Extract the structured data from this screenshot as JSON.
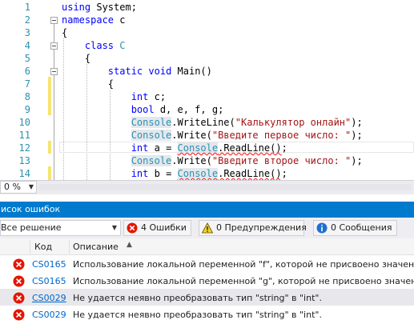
{
  "editor": {
    "lines": [
      {
        "n": "1",
        "html": "<span class=\"kw\">using</span> System;"
      },
      {
        "n": "2",
        "html": "<span class=\"kw\">namespace</span> c"
      },
      {
        "n": "3",
        "html": "{"
      },
      {
        "n": "4",
        "html": "    <span class=\"kw\">class</span> <span class=\"cls\">C</span>"
      },
      {
        "n": "5",
        "html": "    {"
      },
      {
        "n": "6",
        "html": "        <span class=\"kw\">static</span> <span class=\"kw\">void</span> Main()"
      },
      {
        "n": "7",
        "html": "        {"
      },
      {
        "n": "8",
        "html": "            <span class=\"kw\">int</span> c;"
      },
      {
        "n": "9",
        "html": "            <span class=\"kw\">bool</span> d, e, f, g;"
      },
      {
        "n": "10",
        "html": "            <span class=\"console\">Console</span>.WriteLine(<span class=\"str\">\"Калькулятор онлайн\"</span>);"
      },
      {
        "n": "11",
        "html": "            <span class=\"console\">Console</span>.Write(<span class=\"str\">\"Введите первое число: \"</span>);"
      },
      {
        "n": "12",
        "html": "            <span class=\"kw\">int</span> a = <span class=\"console squig\">Console</span><span class=\"squig\">.ReadLine()</span>;"
      },
      {
        "n": "13",
        "html": "            <span class=\"console\">Console</span>.Write(<span class=\"str\">\"Введите второе число: \"</span>);"
      },
      {
        "n": "14",
        "html": "            <span class=\"kw\">int</span> b = <span class=\"console squig\">Console</span><span class=\"squig\">.ReadLine()</span>;"
      }
    ]
  },
  "zoom": {
    "value": "0 %"
  },
  "error_list": {
    "title": "исок ошибок",
    "scope": "Все решение",
    "errors_btn": "4 Ошибки",
    "warnings_btn": "0 Предупреждения",
    "messages_btn": "0 Сообщения",
    "columns": {
      "code": "Код",
      "description": "Описание"
    },
    "rows": [
      {
        "code": "CS0165",
        "desc": "Использование локальной переменной \"f\", которой не присвоено значение."
      },
      {
        "code": "CS0165",
        "desc": "Использование локальной переменной \"g\", которой не присвоено значение."
      },
      {
        "code": "CS0029",
        "desc": "Не удается неявно преобразовать тип \"string\" в \"int\"."
      },
      {
        "code": "CS0029",
        "desc": "Не удается неявно преобразовать тип \"string\" в \"int\"."
      }
    ]
  },
  "colors": {
    "accent": "#007acc",
    "error": "#e51400",
    "warning": "#f5d328",
    "info": "#1f6fd0"
  }
}
